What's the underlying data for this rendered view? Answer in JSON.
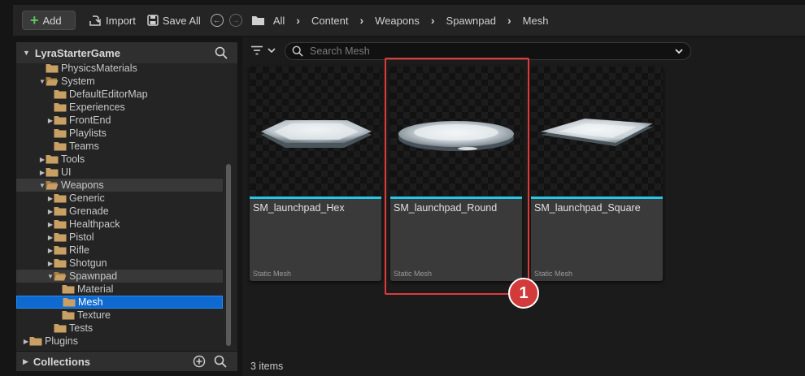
{
  "toolbar": {
    "add_label": "Add",
    "import_label": "Import",
    "save_all_label": "Save All",
    "breadcrumbs": [
      "All",
      "Content",
      "Weapons",
      "Spawnpad",
      "Mesh"
    ]
  },
  "tree": {
    "root_label": "LyraStarterGame",
    "items": [
      {
        "label": "PhysicsMaterials"
      },
      {
        "label": "System"
      },
      {
        "label": "DefaultEditorMap"
      },
      {
        "label": "Experiences"
      },
      {
        "label": "FrontEnd"
      },
      {
        "label": "Playlists"
      },
      {
        "label": "Teams"
      },
      {
        "label": "Tools"
      },
      {
        "label": "UI"
      },
      {
        "label": "Weapons"
      },
      {
        "label": "Generic"
      },
      {
        "label": "Grenade"
      },
      {
        "label": "Healthpack"
      },
      {
        "label": "Pistol"
      },
      {
        "label": "Rifle"
      },
      {
        "label": "Shotgun"
      },
      {
        "label": "Spawnpad"
      },
      {
        "label": "Material"
      },
      {
        "label": "Mesh"
      },
      {
        "label": "Texture"
      },
      {
        "label": "Tests"
      },
      {
        "label": "Plugins"
      }
    ]
  },
  "collections": {
    "label": "Collections"
  },
  "search": {
    "placeholder": "Search Mesh"
  },
  "assets": [
    {
      "name": "SM_launchpad_Hex",
      "type": "Static Mesh"
    },
    {
      "name": "SM_launchpad_Round",
      "type": "Static Mesh"
    },
    {
      "name": "SM_launchpad_Square",
      "type": "Static Mesh"
    }
  ],
  "status": {
    "item_count": "3 items"
  },
  "annotation": {
    "badge": "1"
  },
  "colors": {
    "accent_cyan": "#26c6ea",
    "selection_blue": "#0e6ad0",
    "annotation_red": "#e03a3a",
    "add_green": "#5cc65c"
  }
}
